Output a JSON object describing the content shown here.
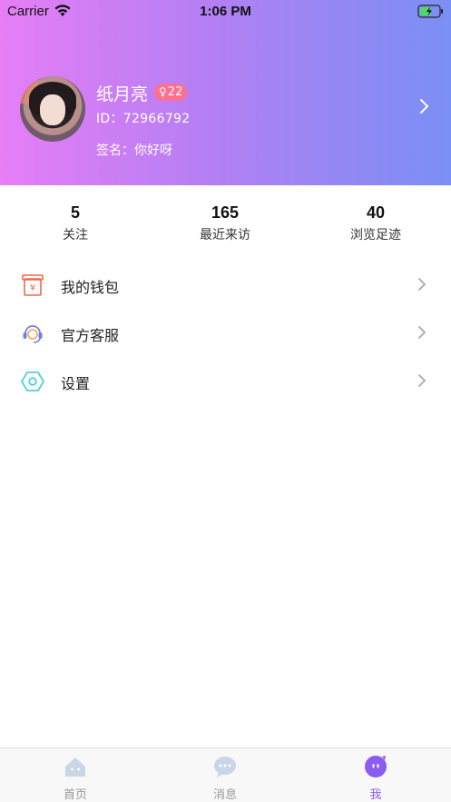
{
  "status_bar": {
    "carrier": "Carrier",
    "time": "1:06 PM"
  },
  "profile": {
    "name": "纸月亮",
    "badge_age": "22",
    "user_id": "ID：72966792",
    "signature": "签名：你好呀"
  },
  "stats": [
    {
      "value": "5",
      "label": "关注"
    },
    {
      "value": "165",
      "label": "最近来访"
    },
    {
      "value": "40",
      "label": "浏览足迹"
    }
  ],
  "menu": [
    {
      "label": "我的钱包",
      "icon": "wallet-icon"
    },
    {
      "label": "官方客服",
      "icon": "customer-service-icon"
    },
    {
      "label": "设置",
      "icon": "settings-icon"
    }
  ],
  "tabbar": [
    {
      "label": "首页",
      "icon": "home-icon"
    },
    {
      "label": "消息",
      "icon": "message-icon"
    },
    {
      "label": "我",
      "icon": "me-icon",
      "active": true
    }
  ],
  "colors": {
    "header_gradient_start": "#e77ef6",
    "header_gradient_end": "#7a8ff5",
    "badge": "#ff6f90",
    "accent": "#8a5cf0"
  }
}
